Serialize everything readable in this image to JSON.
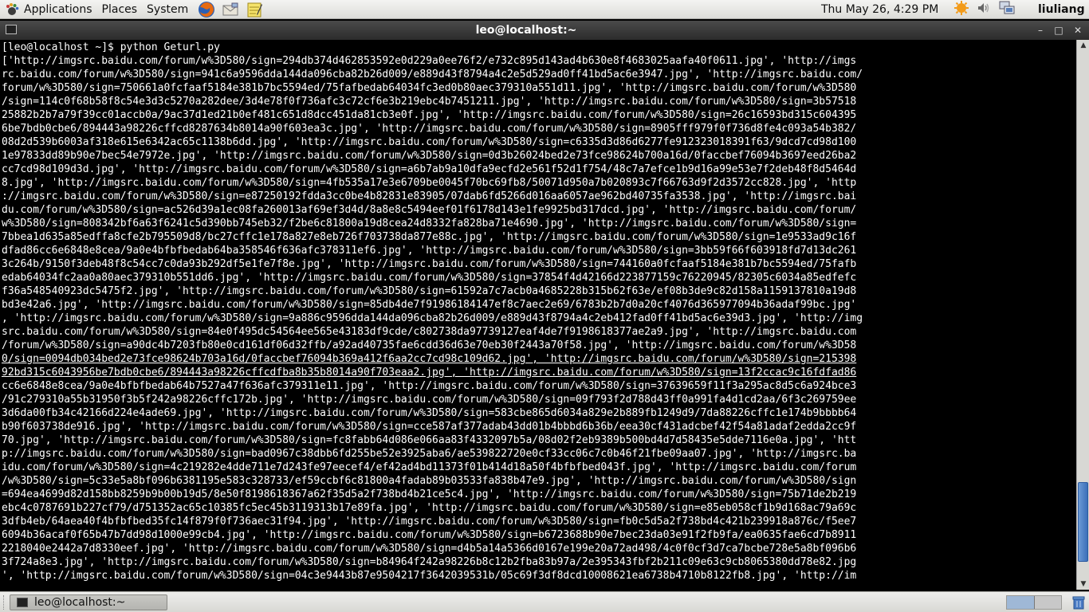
{
  "top_panel": {
    "menus": [
      {
        "label": "Applications",
        "icon": "gnome-foot-icon"
      },
      {
        "label": "Places"
      },
      {
        "label": "System"
      }
    ],
    "launchers": [
      {
        "name": "firefox",
        "icon": "firefox-icon"
      },
      {
        "name": "email",
        "icon": "mail-icon"
      },
      {
        "name": "notes",
        "icon": "notes-icon"
      }
    ],
    "clock": "Thu May 26,  4:29 PM",
    "tray_icons": [
      "updates-icon",
      "volume-icon",
      "network-icon"
    ],
    "username": "liuliang"
  },
  "window": {
    "title": "leo@localhost:~",
    "buttons": {
      "minimize": "–",
      "maximize": "□",
      "close": "✕"
    }
  },
  "terminal": {
    "lines": [
      "[leo@localhost ~]$ python Geturl.py",
      "['http://imgsrc.baidu.com/forum/w%3D580/sign=294db374d462853592e0d229a0ee76f2/e732c895d143ad4b630e8f4683025aafa40f0611.jpg', 'http://imgs",
      "rc.baidu.com/forum/w%3D580/sign=941c6a9596dda144da096cba82b26d009/e889d43f8794a4c2e5d529ad0ff41bd5ac6e3947.jpg', 'http://imgsrc.baidu.com/",
      "forum/w%3D580/sign=750661a0fcfaaf5184e381b7bc5594ed/75fafbedab64034fc3ed0b80aec379310a551d11.jpg', 'http://imgsrc.baidu.com/forum/w%3D580",
      "/sign=114c0f68b58f8c54e3d3c5270a282dee/3d4e78f0f736afc3c72cf6e3b219ebc4b7451211.jpg', 'http://imgsrc.baidu.com/forum/w%3D580/sign=3b57518",
      "25882b2b7a79f39cc01accb0a/9ac37d1ed21b0ef481c651d8dcc451da81cb3e0f.jpg', 'http://imgsrc.baidu.com/forum/w%3D580/sign=26c16593bd315c604395",
      "6be7bdb0cbe6/894443a98226cffcd8287634b8014a90f603ea3c.jpg', 'http://imgsrc.baidu.com/forum/w%3D580/sign=8905fff979f0f736d8fe4c093a54b382/",
      "08d2d539b6003af318e615e6342ac65c1138b6dd.jpg', 'http://imgsrc.baidu.com/forum/w%3D580/sign=c6335d3d86d6277fe912323018391f63/9dcd7cd98d100",
      "1e97833dd89b90e7bec54e7972e.jpg', 'http://imgsrc.baidu.com/forum/w%3D580/sign=0d3b26024bed2e73fce98624b700a16d/0faccbef76094b3697eed26ba2",
      "cc7cd98d109d3d.jpg', 'http://imgsrc.baidu.com/forum/w%3D580/sign=a6b7ab9a10dfa9ecfd2e561f52d1f754/48c7a7efce1b9d16a99e53e7f2deb48f8d5464d",
      "8.jpg', 'http://imgsrc.baidu.com/forum/w%3D580/sign=4fb535a17e3e6709be0045f70bc69fb8/50071d950a7b020893c7f66763d9f2d3572cc828.jpg', 'http",
      "://imgsrc.baidu.com/forum/w%3D580/sign=e87250192fdda3cc0be4b82831e83905/07dab6fd5266d016aa6057ae962bd40735fa3538.jpg', 'http://imgsrc.bai",
      "du.com/forum/w%3D580/sign=ac526d39a1ec08fa260013af69ef3d4d/8a8e8c5494eef01f6178d143e1fe9925bd317dcd.jpg', 'http://imgsrc.baidu.com/forum/",
      "w%3D580/sign=808342bf6a63f6241c5d390bb745eb32/f2be6c81800a19d8cea24d8332fa828ba71e4690.jpg', 'http://imgsrc.baidu.com/forum/w%3D580/sign=",
      "7bbea1d635a85edffa8cfe2b795509d8/bc27cffc1e178a827e8eb726f703738da877e88c.jpg', 'http://imgsrc.baidu.com/forum/w%3D580/sign=1e9533ad9c16f",
      "dfad86cc6e6848e8cea/9a0e4bfbfbedab64ba358546f636afc378311ef6.jpg', 'http://imgsrc.baidu.com/forum/w%3D580/sign=3bb59f66f603918fd7d13dc261",
      "3c264b/9150f3deb48f8c54cc7c0da93b292df5e1fe7f8e.jpg', 'http://imgsrc.baidu.com/forum/w%3D580/sign=744160a0fcfaaf5184e381b7bc5594ed/75fafb",
      "edab64034fc2aa0a80aec379310b551dd6.jpg', 'http://imgsrc.baidu.com/forum/w%3D580/sign=37854f4d42166d223877159c76220945/82305c6034a85edfefc",
      "f36a548540923dc5475f2.jpg', 'http://imgsrc.baidu.com/forum/w%3D580/sign=61592a7c7acb0a4685228b315b62f63e/ef08b3de9c82d158a1159137810a19d8",
      "bd3e42a6.jpg', 'http://imgsrc.baidu.com/forum/w%3D580/sign=85db4de7f91986184147ef8c7aec2e69/6783b2b7d0a20cf4076d365977094b36adaf99bc.jpg'",
      ", 'http://imgsrc.baidu.com/forum/w%3D580/sign=9a886c9596dda144da096cba82b26d009/e889d43f8794a4c2eb412fad0ff41bd5ac6e39d3.jpg', 'http://img",
      "src.baidu.com/forum/w%3D580/sign=84e0f495dc54564ee565e43183df9cde/c802738da97739127eaf4de7f9198618377ae2a9.jpg', 'http://imgsrc.baidu.com",
      "/forum/w%3D580/sign=a90dc4b7203fb80e0cd161df06d32ffb/a92ad40735fae6cdd36d63e70eb30f2443a70f58.jpg', 'http://imgsrc.baidu.com/forum/w%3D58",
      "0/sign=0094db034bed2e73fce98624b703a16d/0faccbef76094b369a412f6aa2cc7cd98c109d62.jpg', 'http://imgsrc.baidu.com/forum/w%3D580/sign=215398",
      "92bd315c6043956be7bdb0cbe6/894443a98226cffcdfba8b35b8014a90f703eaa2.jpg', 'http://imgsrc.baidu.com/forum/w%3D580/sign=13f2ccac9c16fdfad86",
      "cc6e6848e8cea/9a0e4bfbfbedab64b7527a47f636afc379311e11.jpg', 'http://imgsrc.baidu.com/forum/w%3D580/sign=37639659f11f3a295ac8d5c6a924bce3",
      "/91c279310a55b31950f3b5f242a98226cffc172b.jpg', 'http://imgsrc.baidu.com/forum/w%3D580/sign=09f793f2d788d43ff0a991fa4d1cd2aa/6f3c269759ee",
      "3d6da00fb34c42166d224e4ade69.jpg', 'http://imgsrc.baidu.com/forum/w%3D580/sign=583cbe865d6034a829e2b889fb1249d9/7da88226cffc1e174b9bbbb64",
      "b90f603738de916.jpg', 'http://imgsrc.baidu.com/forum/w%3D580/sign=cce587af377adab43dd01b4bbbd6b36b/eea30cf431adcbef42f54a81adaf2edda2cc9f",
      "70.jpg', 'http://imgsrc.baidu.com/forum/w%3D580/sign=fc8fabb64d086e066aa83f4332097b5a/08d02f2eb9389b500bd4d7d58435e5dde7116e0a.jpg', 'htt",
      "p://imgsrc.baidu.com/forum/w%3D580/sign=bad0967c38dbb6fd255be52e3925aba6/ae539822720e0cf33cc06c7c0b46f21fbe09aa07.jpg', 'http://imgsrc.ba",
      "idu.com/forum/w%3D580/sign=4c219282e4dde711e7d243fe97eecef4/ef42ad4bd11373f01b414d18a50f4bfbfbed043f.jpg', 'http://imgsrc.baidu.com/forum",
      "/w%3D580/sign=5c33e5a8bf096b6381195e583c328733/ef59ccbf6c81800a4fadab89b03533fa838b47e9.jpg', 'http://imgsrc.baidu.com/forum/w%3D580/sign",
      "=694ea4699d82d158bb8259b9b00b19d5/8e50f8198618367a62f35d5a2f738bd4b21ce5c4.jpg', 'http://imgsrc.baidu.com/forum/w%3D580/sign=75b71de2b219",
      "ebc4c0787691b227cf79/d751352ac65c10385fc5ec45b3119313b17e89fa.jpg', 'http://imgsrc.baidu.com/forum/w%3D580/sign=e85eb058cf1b9d168ac79a69c",
      "3dfb4eb/64aea40f4bfbfbed35fc14f879f0f736aec31f94.jpg', 'http://imgsrc.baidu.com/forum/w%3D580/sign=fb0c5d5a2f738bd4c421b239918a876c/f5ee7",
      "6094b36acaf0f65b47b7dd98d1000e99cb4.jpg', 'http://imgsrc.baidu.com/forum/w%3D580/sign=b6723688b90e7bec23da03e91f2fb9fa/ea0635fae6cd7b8911",
      "2218040e2442a7d8330eef.jpg', 'http://imgsrc.baidu.com/forum/w%3D580/sign=d4b5a14a5366d0167e199e20a72ad498/4c0f0cf3d7ca7bcbe728e5a8bf096b6",
      "3f724a8e3.jpg', 'http://imgsrc.baidu.com/forum/w%3D580/sign=b84964f242a98226b8c12b2fba83b97a/2e395343fbf2b211c09e63c9cb8065380dd78e82.jpg",
      "', 'http://imgsrc.baidu.com/forum/w%3D580/sign=04c3e9443b87e9504217f3642039531b/05c69f3df8dcd10008621ea6738b4710b8122fb8.jpg', 'http://im"
    ]
  },
  "taskbar": {
    "task_label": "leo@localhost:~",
    "workspaces": 2
  }
}
